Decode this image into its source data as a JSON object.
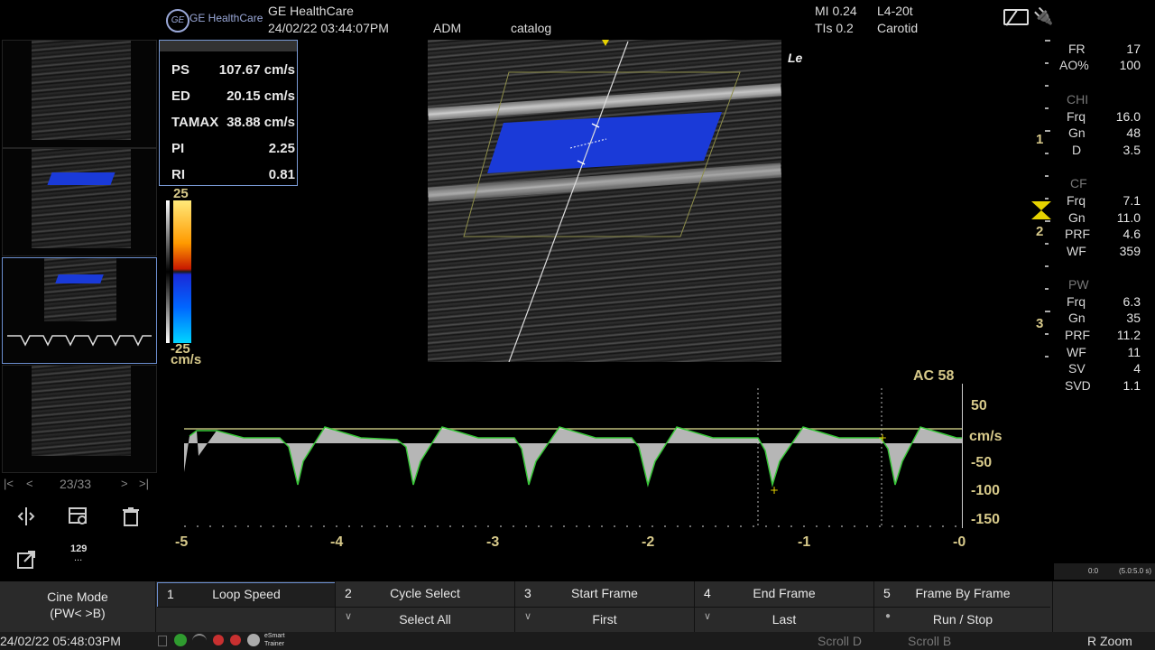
{
  "header": {
    "brand": "GE HealthCare",
    "logo_text": "GE",
    "title": "GE HealthCare",
    "datetime": "24/02/22 03:44:07PM",
    "user": "ADM",
    "catalog": "catalog",
    "mi": "MI 0.24",
    "tis": "TIs 0.2",
    "probe": "L4-20t",
    "preset": "Carotid"
  },
  "measurements": [
    {
      "label": "PS",
      "value": "107.67 cm/s"
    },
    {
      "label": "ED",
      "value": "20.15 cm/s"
    },
    {
      "label": "TAMAX",
      "value": "38.88 cm/s"
    },
    {
      "label": "PI",
      "value": "2.25"
    },
    {
      "label": "RI",
      "value": "0.81"
    }
  ],
  "colorbar": {
    "top": "25",
    "bottom": "-25",
    "unit": "cm/s"
  },
  "image_label": "Le",
  "doppler": {
    "ac_label": "AC 58",
    "y_ticks": [
      "50",
      "cm/s",
      "-50",
      "-100",
      "-150"
    ],
    "x_ticks": [
      "-5",
      "-4",
      "-3",
      "-2",
      "-1",
      "-0"
    ]
  },
  "depth_marks": [
    "1",
    "2",
    "3"
  ],
  "params": {
    "general": [
      {
        "k": "FR",
        "v": "17"
      },
      {
        "k": "AO%",
        "v": "100"
      }
    ],
    "chi_title": "CHI",
    "chi": [
      {
        "k": "Frq",
        "v": "16.0"
      },
      {
        "k": "Gn",
        "v": "48"
      },
      {
        "k": "D",
        "v": "3.5"
      }
    ],
    "cf_title": "CF",
    "cf": [
      {
        "k": "Frq",
        "v": "7.1"
      },
      {
        "k": "Gn",
        "v": "11.0"
      },
      {
        "k": "PRF",
        "v": "4.6"
      },
      {
        "k": "WF",
        "v": "359"
      }
    ],
    "pw_title": "PW",
    "pw": [
      {
        "k": "Frq",
        "v": "6.3"
      },
      {
        "k": "Gn",
        "v": "35"
      },
      {
        "k": "PRF",
        "v": "11.2"
      },
      {
        "k": "WF",
        "v": "11"
      },
      {
        "k": "SV",
        "v": "4"
      },
      {
        "k": "SVD",
        "v": "1.1"
      }
    ]
  },
  "thumbnails": {
    "counter": "23/33",
    "nav_first": "|<",
    "nav_prev": "<",
    "nav_next": ">",
    "nav_last": ">|",
    "count_badge": "129",
    "count_sub": "..."
  },
  "cine_info": {
    "left": "0:0",
    "right": "(5.0:5.0 s)"
  },
  "softkeys": {
    "mode_line1": "Cine Mode",
    "mode_line2": "(PW< >B)",
    "top": [
      {
        "num": "1",
        "label": "Loop Speed"
      },
      {
        "num": "2",
        "label": "Cycle Select"
      },
      {
        "num": "3",
        "label": "Start Frame"
      },
      {
        "num": "4",
        "label": "End Frame"
      },
      {
        "num": "5",
        "label": "Frame By Frame"
      }
    ],
    "bottom": [
      {
        "label": ""
      },
      {
        "label": "Select All"
      },
      {
        "label": "First"
      },
      {
        "label": "Last"
      },
      {
        "label": "Run / Stop"
      }
    ]
  },
  "status": {
    "datetime": "24/02/22 05:48:03PM",
    "esmart_line1": "eSmart",
    "esmart_line2": "Trainer",
    "scroll_d": "Scroll D",
    "scroll_b": "Scroll B",
    "rzoom": "R Zoom"
  },
  "colors": {
    "accent": "#d7c98a",
    "border": "#7a9bd6",
    "flow": "#1a3ad8",
    "trace": "#38c738"
  }
}
